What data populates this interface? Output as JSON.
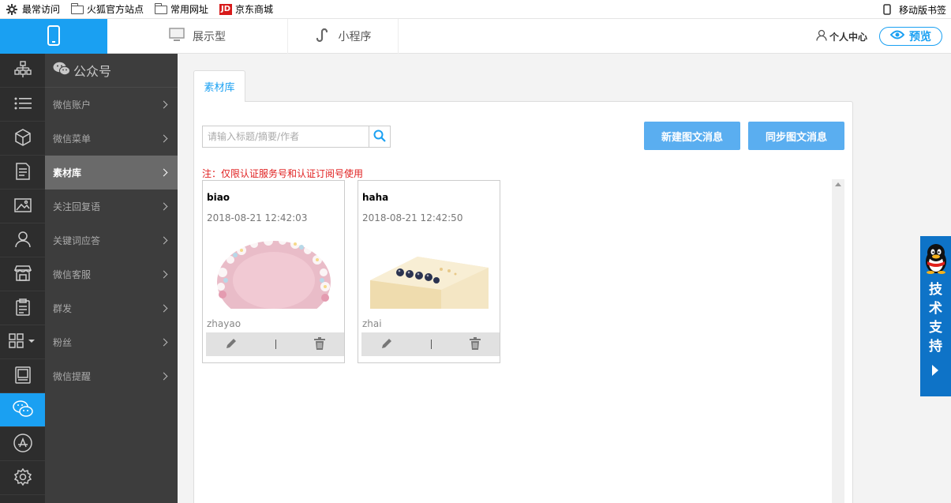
{
  "bookmarks": {
    "items": [
      {
        "label": "最常访问",
        "icon": "gear-icon"
      },
      {
        "label": "火狐官方站点",
        "icon": "folder-icon"
      },
      {
        "label": "常用网址",
        "icon": "folder-icon"
      },
      {
        "label": "京东商城",
        "icon": "jd-logo-icon"
      }
    ],
    "mobile": "移动版书签",
    "jd_logo_text": "JD"
  },
  "header": {
    "tabs": [
      {
        "label": "展示型",
        "icon": "monitor-icon"
      },
      {
        "label": "小程序",
        "icon": "mini-program-icon"
      }
    ],
    "user_center": "个人中心",
    "preview": "预览",
    "accent": "#1aa0f2"
  },
  "rail": {
    "items": [
      "sitemap-icon",
      "list-icon",
      "cube-icon",
      "document-icon",
      "image-icon",
      "user-icon",
      "store-icon",
      "clipboard-icon",
      "grid-icon",
      "picture-frame-icon",
      "wechat-icon",
      "appstore-icon",
      "gear-icon"
    ],
    "active_index": 10
  },
  "subnav": {
    "title": "公众号",
    "items": [
      {
        "label": "微信账户"
      },
      {
        "label": "微信菜单"
      },
      {
        "label": "素材库",
        "active": true
      },
      {
        "label": "关注回复语"
      },
      {
        "label": "关键词应答"
      },
      {
        "label": "微信客服"
      },
      {
        "label": "群发"
      },
      {
        "label": "粉丝"
      },
      {
        "label": "微信提醒"
      }
    ]
  },
  "main": {
    "tab": "素材库",
    "search": {
      "placeholder": "请输入标题/摘要/作者",
      "value": ""
    },
    "new_button": "新建图文消息",
    "sync_button": "同步图文消息",
    "notice": "注：仅限认证服务号和认证订阅号使用",
    "cards": [
      {
        "title": "biao",
        "date": "2018-08-21 12:42:03",
        "author": "zhayao",
        "image": "pink-cake-image"
      },
      {
        "title": "haha",
        "date": "2018-08-21 12:42:50",
        "author": "zhai",
        "image": "blueberry-cake-image"
      }
    ]
  },
  "support": {
    "label": "技术支持",
    "chars": [
      "技",
      "术",
      "支",
      "持"
    ],
    "icon": "qq-penguin-icon",
    "color": "#0e73c7"
  }
}
